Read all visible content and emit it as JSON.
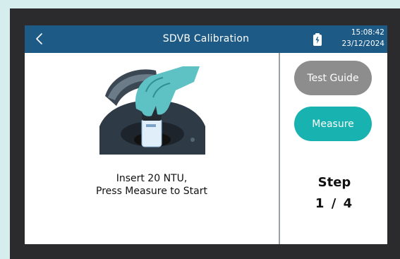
{
  "header": {
    "title": "SDVB Calibration",
    "time": "15:08:42",
    "date": "23/12/2024",
    "back_icon": "chevron-left-icon",
    "battery_icon": "battery-icon"
  },
  "main": {
    "instruction_line1": "Insert 20 NTU,",
    "instruction_line2": "Press Measure to Start"
  },
  "side": {
    "test_guide_label": "Test Guide",
    "measure_label": "Measure",
    "step_label": "Step",
    "step_current": "1",
    "step_separator": "/",
    "step_total": "4"
  },
  "colors": {
    "header": "#1d5b86",
    "accent": "#18b3b1",
    "guide_button": "#8d8d8d",
    "bezel": "#2b2b2d"
  }
}
